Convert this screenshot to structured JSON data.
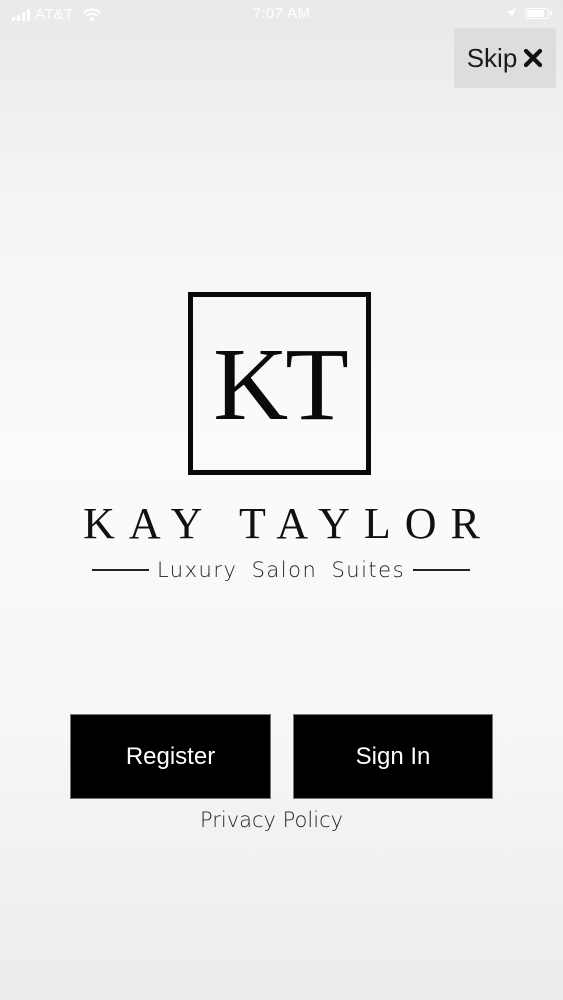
{
  "status_bar": {
    "carrier": "AT&T",
    "time": "7:07 AM",
    "icons": [
      "signal-icon",
      "wifi-icon",
      "location-icon",
      "battery-icon"
    ]
  },
  "skip": {
    "label": "Skip",
    "icon": "close-icon"
  },
  "logo": {
    "monogram": "KT",
    "brand_name": "KAY TAYLOR",
    "tagline": "Luxury Salon Suites"
  },
  "actions": {
    "register_label": "Register",
    "signin_label": "Sign In"
  },
  "privacy_link": "Privacy Policy",
  "colors": {
    "button_background": "#000000",
    "button_text": "#ffffff",
    "skip_background": "#dddddd",
    "brand_ink": "#0a0a0a"
  }
}
